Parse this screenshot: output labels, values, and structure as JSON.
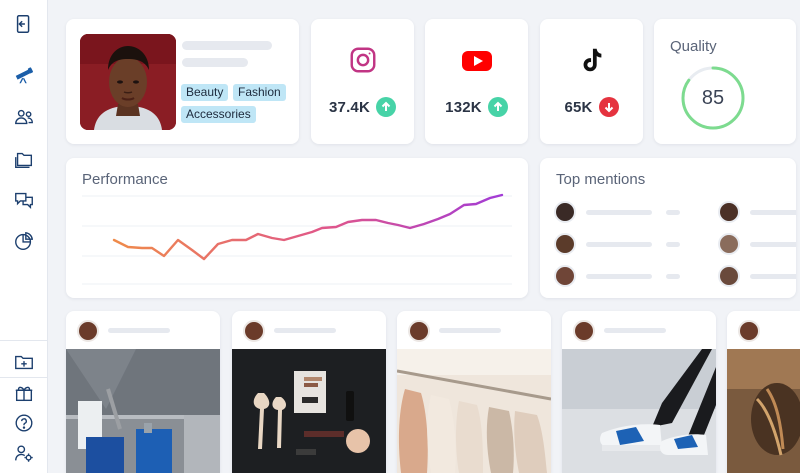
{
  "sidebar": {
    "top_icons": [
      "logout-icon",
      "telescope-icon",
      "users-icon",
      "folders-icon",
      "chat-icon",
      "pie-chart-icon"
    ],
    "bottom_icons": [
      "folder-plus-icon",
      "gift-icon",
      "help-icon",
      "user-settings-icon"
    ],
    "active": "telescope-icon"
  },
  "profile": {
    "tags": [
      "Beauty",
      "Fashion",
      "Accessories"
    ]
  },
  "stats": [
    {
      "platform": "instagram-icon",
      "value": "37.4K",
      "trend": "up"
    },
    {
      "platform": "youtube-icon",
      "value": "132K",
      "trend": "up"
    },
    {
      "platform": "tiktok-icon",
      "value": "65K",
      "trend": "down"
    }
  ],
  "quality": {
    "title": "Quality",
    "value": "85",
    "fraction": 0.85
  },
  "performance": {
    "title": "Performance"
  },
  "mentions": {
    "title": "Top mentions"
  },
  "colors": {
    "accent_up": "#47d3a7",
    "accent_down": "#e5333f",
    "tag_bg": "#bfe6f6",
    "quality_ring": "#7ddb8f",
    "sidebar_active": "#1b5ea8",
    "instagram": "#c13584",
    "youtube": "#ff0000"
  }
}
